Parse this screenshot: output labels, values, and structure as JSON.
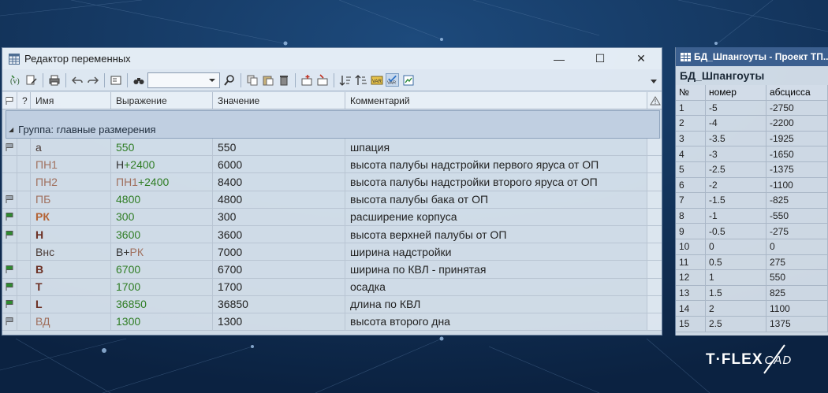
{
  "window": {
    "title": "Редактор переменных",
    "controls": {
      "minimize": "—",
      "maximize": "☐",
      "close": "✕"
    }
  },
  "columns": {
    "flag": "",
    "help": "?",
    "name": "Имя",
    "expression": "Выражение",
    "value": "Значение",
    "comment": "Комментарий",
    "warning": "⚠"
  },
  "group": {
    "label": "Группа: главные размерения"
  },
  "variables": [
    {
      "flag": "grey",
      "name": "a",
      "name_style": "plain",
      "expr": [
        {
          "t": "550",
          "s": "num"
        }
      ],
      "value": "550",
      "comment": "шпация"
    },
    {
      "flag": "none",
      "name": "ПН1",
      "name_style": "muted",
      "expr": [
        {
          "t": "Н",
          "s": "plain"
        },
        {
          "t": "+2400",
          "s": "num"
        }
      ],
      "value": "6000",
      "comment": "высота палубы надстройки первого яруса от ОП"
    },
    {
      "flag": "none",
      "name": "ПН2",
      "name_style": "muted",
      "expr": [
        {
          "t": "ПН1",
          "s": "ref"
        },
        {
          "t": "+2400",
          "s": "num"
        }
      ],
      "value": "8400",
      "comment": "высота палубы надстройки второго яруса от ОП"
    },
    {
      "flag": "grey",
      "name": "ПБ",
      "name_style": "muted",
      "expr": [
        {
          "t": "4800",
          "s": "num"
        }
      ],
      "value": "4800",
      "comment": "высота палубы бака от ОП"
    },
    {
      "flag": "green",
      "name": "РК",
      "name_style": "orange",
      "expr": [
        {
          "t": "300",
          "s": "num"
        }
      ],
      "value": "300",
      "comment": "расширение корпуса"
    },
    {
      "flag": "green",
      "name": "Н",
      "name_style": "bold",
      "expr": [
        {
          "t": "3600",
          "s": "num"
        }
      ],
      "value": "3600",
      "comment": "высота верхней палубы от ОП"
    },
    {
      "flag": "none",
      "name": "Внс",
      "name_style": "plain",
      "expr": [
        {
          "t": "В+",
          "s": "plain"
        },
        {
          "t": "РК",
          "s": "ref"
        }
      ],
      "value": "7000",
      "comment": "ширина надстройки"
    },
    {
      "flag": "green",
      "name": "В",
      "name_style": "bold",
      "expr": [
        {
          "t": "6700",
          "s": "num"
        }
      ],
      "value": "6700",
      "comment": "ширина по КВЛ - принятая"
    },
    {
      "flag": "green",
      "name": "Т",
      "name_style": "bold",
      "expr": [
        {
          "t": "1700",
          "s": "num"
        }
      ],
      "value": "1700",
      "comment": "осадка"
    },
    {
      "flag": "green",
      "name": "L",
      "name_style": "bold",
      "expr": [
        {
          "t": "36850",
          "s": "num"
        }
      ],
      "value": "36850",
      "comment": "длина по КВЛ"
    },
    {
      "flag": "grey",
      "name": "ВД",
      "name_style": "muted",
      "expr": [
        {
          "t": "1300",
          "s": "num"
        }
      ],
      "value": "1300",
      "comment": "высота второго дна"
    }
  ],
  "database": {
    "window_title": "БД_Шпангоуты - Проект ТП...",
    "name": "БД_Шпангоуты",
    "columns": [
      "№",
      "номер",
      "абсцисса"
    ],
    "rows": [
      [
        "1",
        "-5",
        "-2750"
      ],
      [
        "2",
        "-4",
        "-2200"
      ],
      [
        "3",
        "-3.5",
        "-1925"
      ],
      [
        "4",
        "-3",
        "-1650"
      ],
      [
        "5",
        "-2.5",
        "-1375"
      ],
      [
        "6",
        "-2",
        "-1100"
      ],
      [
        "7",
        "-1.5",
        "-825"
      ],
      [
        "8",
        "-1",
        "-550"
      ],
      [
        "9",
        "-0.5",
        "-275"
      ],
      [
        "10",
        "0",
        "0"
      ],
      [
        "11",
        "0.5",
        "275"
      ],
      [
        "12",
        "1",
        "550"
      ],
      [
        "13",
        "1.5",
        "825"
      ],
      [
        "14",
        "2",
        "1100"
      ],
      [
        "15",
        "2.5",
        "1375"
      ]
    ]
  },
  "logo": {
    "main": "T·FLEX",
    "sub": "CAD"
  },
  "colors": {
    "background": "#0f2a4d",
    "flag_green": "#2f8a2f",
    "flag_grey": "#9aa3ad",
    "expr_number": "#2f7d24",
    "db_title": "#3b5f8f"
  },
  "toolbar_icons": [
    "variable-create-icon",
    "variable-edit-icon",
    "print-icon",
    "undo-icon",
    "redo-icon",
    "frame-icon",
    "binoculars-icon",
    "search-icon",
    "copy-icon",
    "paste-icon",
    "delete-icon",
    "add-row-icon",
    "insert-icon",
    "sort-asc-icon",
    "sort-desc-icon",
    "var-icon",
    "var-check-icon",
    "image-icon"
  ]
}
